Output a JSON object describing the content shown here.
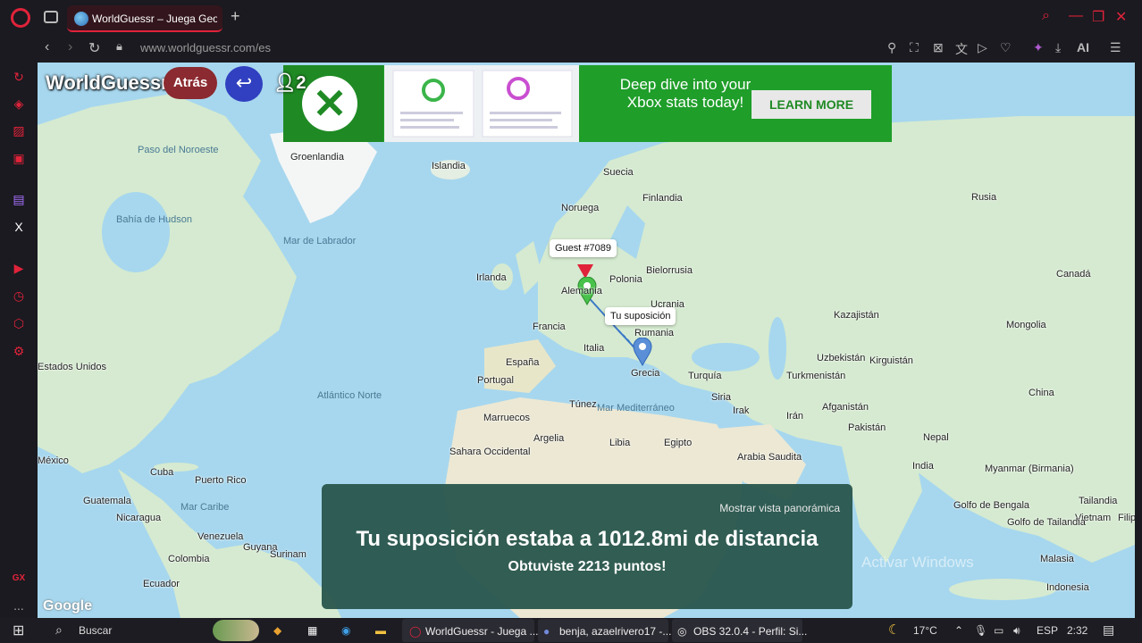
{
  "browser": {
    "tab_title": "WorldGuessr – Juega GeoG",
    "new_tab": "+",
    "url": "www.worldguessr.com/es",
    "window_controls": [
      "search-icon",
      "minimize-icon",
      "restore-icon",
      "close-icon"
    ],
    "toolbar_ai": "AI"
  },
  "sidebar": {
    "items": [
      "refresh-icon",
      "bag-icon",
      "twitch-game-icon",
      "media-icon",
      "twitch-icon",
      "x-icon",
      "player-icon",
      "history-icon",
      "extensions-icon",
      "settings-icon",
      "gx-icon",
      "more-icon"
    ],
    "gx_label": "GX",
    "x_label": "X",
    "more_label": "..."
  },
  "game": {
    "brand": "WorldGuessr",
    "back_label": "Atrás",
    "return_icon": "↩",
    "players": "2",
    "ad": {
      "text": "Deep dive into your Xbox stats today!",
      "button": "LEARN MORE"
    },
    "tooltip_player": "Guest #7089",
    "tooltip_guess": "Tu suposición",
    "result": {
      "panorama_link": "Mostrar vista panorámica",
      "distance": "Tu suposición estaba a 1012.8mi de distancia",
      "points": "Obtuviste 2213 puntos!"
    },
    "activate_windows": "Activar Windows",
    "google": "Google"
  },
  "map_labels": [
    {
      "text": "Paso del Noroeste"
    },
    {
      "text": "Groenlandia"
    },
    {
      "text": "Islandia"
    },
    {
      "text": "Suecia"
    },
    {
      "text": "Finlandia"
    },
    {
      "text": "Noruega"
    },
    {
      "text": "Rusia"
    },
    {
      "text": "Bahía de Hudson"
    },
    {
      "text": "Mar de Labrador"
    },
    {
      "text": "Irlanda"
    },
    {
      "text": "Bielorrusia"
    },
    {
      "text": "Polonia"
    },
    {
      "text": "Alemania"
    },
    {
      "text": "Ucrania"
    },
    {
      "text": "Kazajistán"
    },
    {
      "text": "Mongolia"
    },
    {
      "text": "Canadá"
    },
    {
      "text": "Francia"
    },
    {
      "text": "Rumania"
    },
    {
      "text": "Italia"
    },
    {
      "text": "España"
    },
    {
      "text": "Portugal"
    },
    {
      "text": "Grecia"
    },
    {
      "text": "Turquía"
    },
    {
      "text": "Uzbekistán"
    },
    {
      "text": "Kirguistán"
    },
    {
      "text": "Turkmenistán"
    },
    {
      "text": "Estados Unidos"
    },
    {
      "text": "Atlántico Norte"
    },
    {
      "text": "Túnez"
    },
    {
      "text": "Mar Mediterráneo"
    },
    {
      "text": "Siria"
    },
    {
      "text": "Irak"
    },
    {
      "text": "Irán"
    },
    {
      "text": "Afganistán"
    },
    {
      "text": "China"
    },
    {
      "text": "Pakistán"
    },
    {
      "text": "Marruecos"
    },
    {
      "text": "Argelia"
    },
    {
      "text": "Libia"
    },
    {
      "text": "Egipto"
    },
    {
      "text": "Nepal"
    },
    {
      "text": "Sahara Occidental"
    },
    {
      "text": "Arabia Saudita"
    },
    {
      "text": "India"
    },
    {
      "text": "Myanmar (Birmania)"
    },
    {
      "text": "México"
    },
    {
      "text": "Cuba"
    },
    {
      "text": "Puerto Rico"
    },
    {
      "text": "Guatemala"
    },
    {
      "text": "Mar Caribe"
    },
    {
      "text": "Nicaragua"
    },
    {
      "text": "Golfo de Bengala"
    },
    {
      "text": "Tailandia"
    },
    {
      "text": "Vietnam"
    },
    {
      "text": "Filipinas"
    },
    {
      "text": "Venezuela"
    },
    {
      "text": "Guyana"
    },
    {
      "text": "Colombia"
    },
    {
      "text": "Surinam"
    },
    {
      "text": "Malasia"
    },
    {
      "text": "Ecuador"
    },
    {
      "text": "Indonesia"
    },
    {
      "text": "Golfo de Tailandia"
    }
  ],
  "taskbar": {
    "search": "Buscar",
    "apps": [
      {
        "label": "WorldGuessr - Juega ..."
      },
      {
        "label": "benja, azaelrivero17 -..."
      },
      {
        "label": "OBS 32.0.4 - Perfil: Si..."
      }
    ],
    "temperature": "17°C",
    "language": "ESP",
    "time": "2:32"
  },
  "colors": {
    "accent": "#e0233a",
    "result_bg": "#28554b",
    "ad_green": "#1f9e2a",
    "ocean": "#a7d7ee",
    "land": "#cfe8c4"
  }
}
